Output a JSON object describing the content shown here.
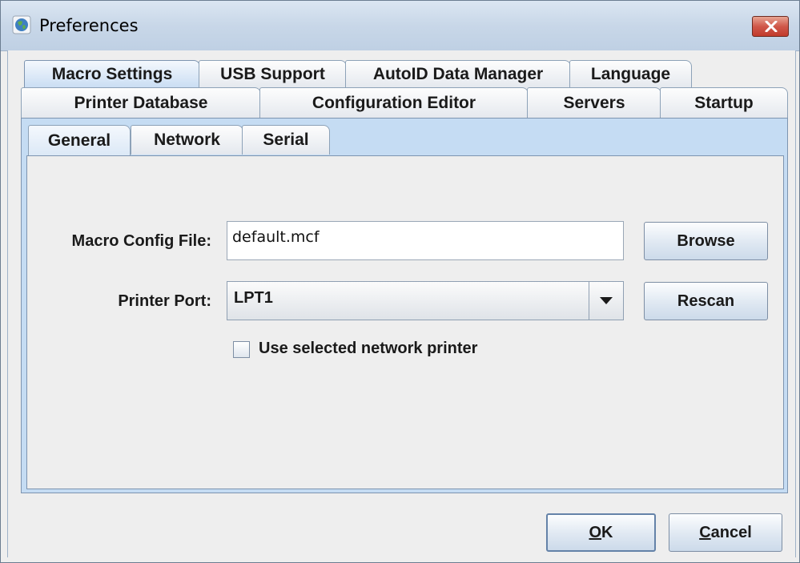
{
  "window": {
    "title": "Preferences"
  },
  "outer_tabs": {
    "row1": [
      {
        "label": "Macro Settings",
        "selected": true
      },
      {
        "label": "USB Support",
        "selected": false
      },
      {
        "label": "AutoID Data Manager",
        "selected": false
      },
      {
        "label": "Language",
        "selected": false
      }
    ],
    "row2": [
      {
        "label": "Printer Database",
        "selected": false
      },
      {
        "label": "Configuration Editor",
        "selected": false
      },
      {
        "label": "Servers",
        "selected": false
      },
      {
        "label": "Startup",
        "selected": false
      }
    ]
  },
  "inner_tabs": [
    {
      "label": "General",
      "selected": true
    },
    {
      "label": "Network",
      "selected": false
    },
    {
      "label": "Serial",
      "selected": false
    }
  ],
  "form": {
    "macro_config_label": "Macro Config File:",
    "macro_config_value": "default.mcf",
    "browse_label": "Browse",
    "printer_port_label": "Printer Port:",
    "printer_port_value": "LPT1",
    "rescan_label": "Rescan",
    "use_network_printer_label": "Use selected network printer",
    "use_network_printer_checked": false
  },
  "footer": {
    "ok_mnemonic": "O",
    "ok_rest": "K",
    "cancel_mnemonic": "C",
    "cancel_rest": "ancel"
  },
  "colors": {
    "selected_tab": "#c9ddf3",
    "panel_blue": "#c5dcf3",
    "window_bg": "#eeeeee",
    "close_button": "#c13a2b"
  },
  "icons": {
    "app": "globe-icon",
    "close": "close-icon",
    "dropdown": "triangle-down-icon"
  }
}
